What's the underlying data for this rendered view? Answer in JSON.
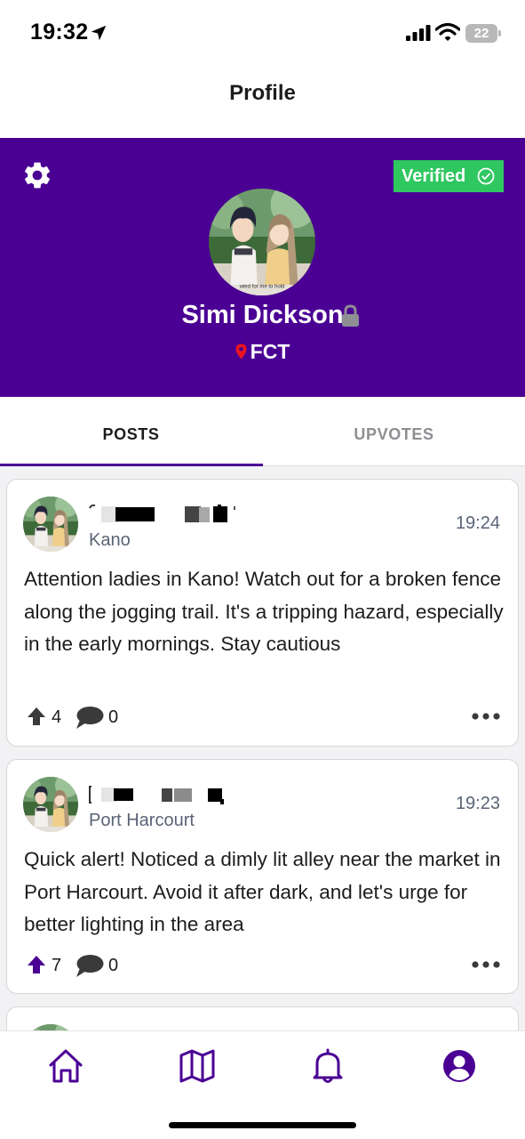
{
  "status_bar": {
    "time": "19:32",
    "battery": "22",
    "icons": [
      "location-arrow-icon",
      "signal-icon",
      "wifi-icon",
      "battery-icon"
    ]
  },
  "header": {
    "title": "Profile"
  },
  "profile": {
    "verified_label": "Verified",
    "name": "Simi Dickson",
    "location": "FCT",
    "avatar_caption": "wied for me to hold",
    "colors": {
      "banner": "#4b0094",
      "verified": "#2ec760",
      "pin": "#e8141f",
      "lock": "#8e8e93"
    }
  },
  "tabs": [
    {
      "label": "POSTS",
      "active": true
    },
    {
      "label": "UPVOTES",
      "active": false
    }
  ],
  "posts": [
    {
      "location": "Kano",
      "time": "19:24",
      "text": "Attention ladies in Kano! Watch out for a broken fence along the jogging trail. It's a tripping hazard, especially in the early mornings. Stay cautious",
      "upvotes": "4",
      "comments": "0",
      "upvoted": false
    },
    {
      "location": "Port Harcourt",
      "time": "19:23",
      "text": "Quick alert! Noticed a dimly lit alley near the market in Port Harcourt. Avoid it after dark, and let's urge for better lighting in the area",
      "upvotes": "7",
      "comments": "0",
      "upvoted": true
    }
  ],
  "bottom_nav": [
    "home-icon",
    "map-icon",
    "bell-icon",
    "profile-icon"
  ],
  "accent_color": "#4b0094"
}
